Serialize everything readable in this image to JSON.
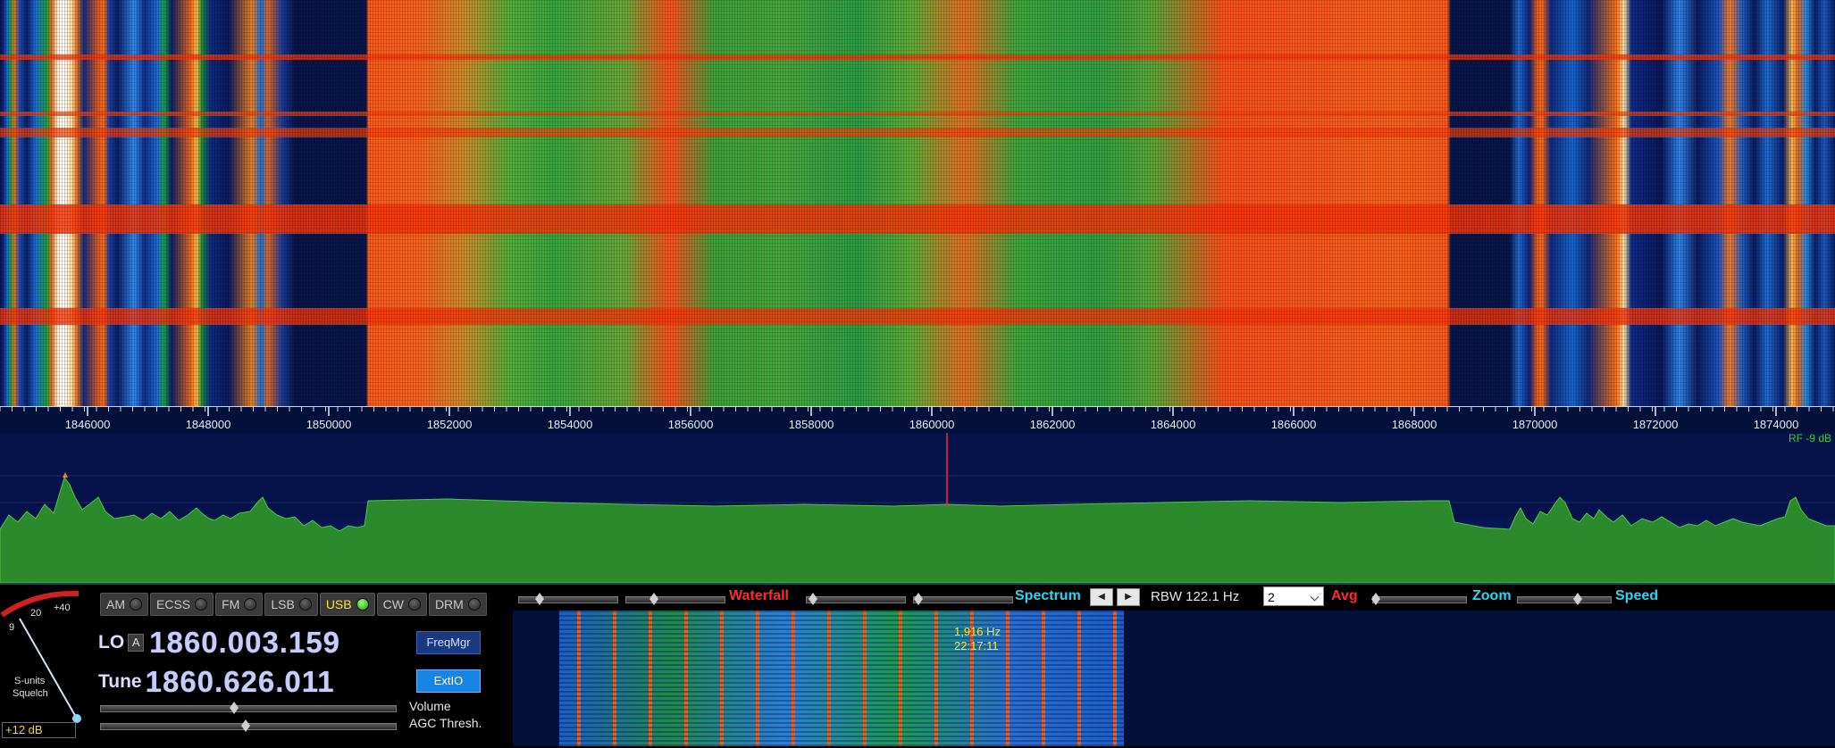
{
  "waterfall": {
    "freq_ticks": [
      "1846000",
      "1848000",
      "1850000",
      "1852000",
      "1854000",
      "1856000",
      "1858000",
      "1860000",
      "1862000",
      "1864000",
      "1866000",
      "1868000",
      "1870000",
      "1872000",
      "1874000"
    ]
  },
  "spectrum": {
    "rf_readout": "RF  -9 dB"
  },
  "smeter": {
    "scale_9": "9",
    "scale_20": "20",
    "scale_40": "+40",
    "label_line1": "S-units",
    "label_line2": "Squelch",
    "readout": "+12 dB"
  },
  "modes": [
    {
      "label": "AM",
      "active": false
    },
    {
      "label": "ECSS",
      "active": false
    },
    {
      "label": "FM",
      "active": false
    },
    {
      "label": "LSB",
      "active": false
    },
    {
      "label": "USB",
      "active": true
    },
    {
      "label": "CW",
      "active": false
    },
    {
      "label": "DRM",
      "active": false
    }
  ],
  "lo": {
    "label": "LO",
    "vfo": "A",
    "freq": "1860.003.159"
  },
  "tune": {
    "label": "Tune",
    "freq": "1860.626.011"
  },
  "buttons": {
    "freqmgr": "FreqMgr",
    "extio": "ExtIO"
  },
  "sliders": {
    "volume_label": "Volume",
    "agc_label": "AGC Thresh.",
    "volume_level": 0.45,
    "agc_level": 0.49
  },
  "controls": {
    "waterfall_label": "Waterfall",
    "spectrum_label": "Spectrum",
    "rbw": "RBW  122.1 Hz",
    "avg_value": "2",
    "avg_label": "Avg",
    "zoom_label": "Zoom",
    "speed_label": "Speed",
    "left_arrow": "◀",
    "right_arrow": "▶"
  },
  "mini_waterfall": {
    "cursor_freq": "1,916 Hz",
    "cursor_time": "22:17:11"
  },
  "colors": {
    "background": "#02103a",
    "accent_red": "#ff2a2a",
    "accent_cyan": "#2ad6f0",
    "active_mode": "#ffe028",
    "spectrum_fill": "#2a8a2a"
  }
}
